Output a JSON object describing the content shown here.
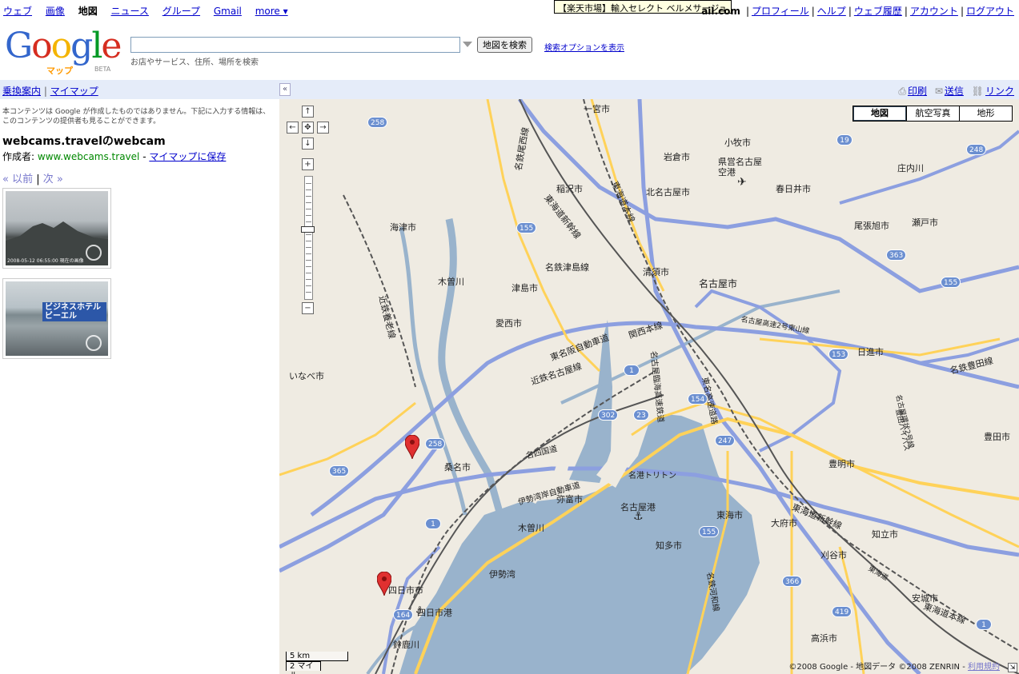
{
  "topnav": {
    "items": [
      {
        "label": "ウェブ",
        "current": false
      },
      {
        "label": "画像",
        "current": false
      },
      {
        "label": "地図",
        "current": true
      },
      {
        "label": "ニュース",
        "current": false
      },
      {
        "label": "グループ",
        "current": false
      },
      {
        "label": "Gmail",
        "current": false
      },
      {
        "label": "more ▾",
        "current": false
      }
    ],
    "tooltip": "【楽天市場】輸入セレクト ベルメサージュ",
    "account_email": "ail.com",
    "account_links": [
      "プロフィール",
      "ヘルプ",
      "ウェブ履歴",
      "アカウント",
      "ログアウト"
    ]
  },
  "header": {
    "logo_text": "Google",
    "logo_sub": "マップ",
    "logo_beta": "BETA",
    "search_value": "",
    "search_hint": "お店やサービス、住所、場所を検索",
    "search_button": "地図を検索",
    "search_options": "検索オプションを表示"
  },
  "sidebar": {
    "top_links": [
      "乗換案内",
      "マイマップ"
    ],
    "notice": "本コンテンツは Google が作成したものではありません。下記に入力する情報は、このコンテンツの提供者も見ることができます。",
    "title": "webcams.travelのwebcam",
    "author_label": "作成者:",
    "author_site": "www.webcams.travel",
    "save_link": "マイマップに保存",
    "prev": "« 以前",
    "next": "次 »",
    "thumb1_caption": "2008-05-12 06:55:00 現在の画像",
    "thumb2_sign": "ビジネスホテル ビーエル"
  },
  "map": {
    "toolbar": {
      "print": "印刷",
      "send": "送信",
      "link": "リンク",
      "collapse": "«"
    },
    "types": [
      "地図",
      "航空写真",
      "地形"
    ],
    "scale_km": "5 km",
    "scale_mi": "2 マイル",
    "copyright": "©2008 Google - 地図データ ©2008 ZENRIN - ",
    "terms": "利用規約",
    "cities": [
      {
        "name": "一宮市"
      },
      {
        "name": "岩倉市"
      },
      {
        "name": "小牧市"
      },
      {
        "name": "県営名古屋空港"
      },
      {
        "name": "稲沢市"
      },
      {
        "name": "北名古屋市"
      },
      {
        "name": "春日井市"
      },
      {
        "name": "庄内川"
      },
      {
        "name": "海津市"
      },
      {
        "name": "尾張旭市"
      },
      {
        "name": "瀬戸市"
      },
      {
        "name": "木曽川"
      },
      {
        "name": "津島市"
      },
      {
        "name": "清須市"
      },
      {
        "name": "名古屋市"
      },
      {
        "name": "愛西市"
      },
      {
        "name": "日進市"
      },
      {
        "name": "いなべ市"
      },
      {
        "name": "桑名市"
      },
      {
        "name": "豊明市"
      },
      {
        "name": "弥富市"
      },
      {
        "name": "名古屋港"
      },
      {
        "name": "東海市"
      },
      {
        "name": "大府市"
      },
      {
        "name": "木曽川"
      },
      {
        "name": "知多市"
      },
      {
        "name": "知立市"
      },
      {
        "name": "刈谷市"
      },
      {
        "name": "伊勢湾"
      },
      {
        "name": "四日市市"
      },
      {
        "name": "四日市港"
      },
      {
        "name": "安城市"
      },
      {
        "name": "高浜市"
      },
      {
        "name": "鈴鹿川"
      },
      {
        "name": "豊田市"
      }
    ],
    "lines": [
      {
        "name": "名鉄尾西線"
      },
      {
        "name": "東海道新幹線"
      },
      {
        "name": "東海道本線"
      },
      {
        "name": "名鉄津島線"
      },
      {
        "name": "関西本線"
      },
      {
        "name": "近鉄名古屋線"
      },
      {
        "name": "東名阪自動車道"
      },
      {
        "name": "名古屋高速2号東山線"
      },
      {
        "name": "名鉄豊田線"
      },
      {
        "name": "名古屋環状2号線"
      },
      {
        "name": "伊勢湾岸自動車道"
      },
      {
        "name": "名四国道"
      },
      {
        "name": "名港トリトン"
      },
      {
        "name": "近鉄養老線"
      },
      {
        "name": "東名高速道路"
      },
      {
        "name": "東海道"
      },
      {
        "name": "名鉄河和線"
      },
      {
        "name": "名古屋臨海高速鉄道"
      },
      {
        "name": "豊田バイパス"
      },
      {
        "name": "東海道新幹線"
      },
      {
        "name": "東海道本線"
      },
      {
        "name": "国道19号線"
      },
      {
        "name": "豊田市"
      }
    ],
    "shields": [
      "258",
      "19",
      "248",
      "155",
      "363",
      "155",
      "1",
      "153",
      "302",
      "23",
      "154",
      "247",
      "258",
      "365",
      "1",
      "155",
      "366",
      "419",
      "164",
      "1"
    ]
  },
  "colors": {
    "water": "#99b3cc",
    "highway": "#8c9fe0",
    "major_road": "#ffd259",
    "land": "#efebe2",
    "panel": "#e5ecf9",
    "marker": "#e03030"
  }
}
